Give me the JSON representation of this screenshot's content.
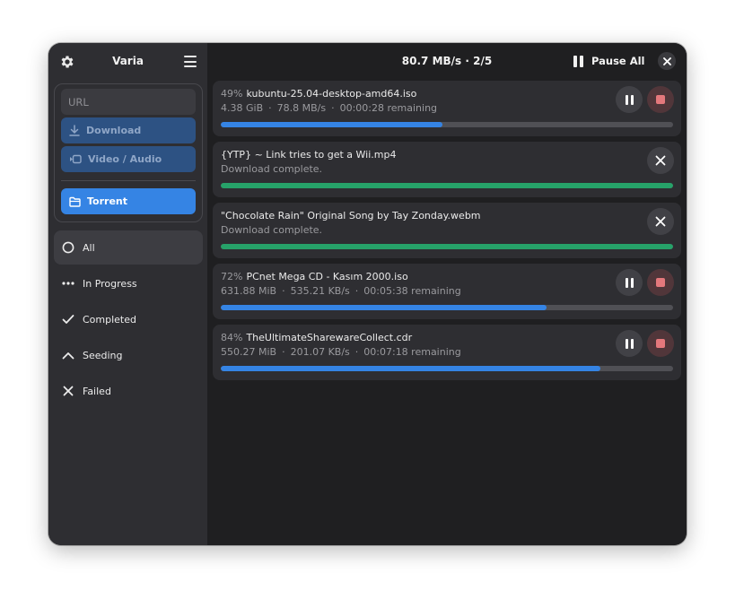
{
  "app": {
    "title": "Varia"
  },
  "sidebar": {
    "url_placeholder": "URL",
    "download_label": "Download",
    "video_audio_label": "Video / Audio",
    "torrent_label": "Torrent",
    "filters": [
      {
        "label": "All",
        "icon": "circle-icon",
        "active": true
      },
      {
        "label": "In Progress",
        "icon": "dots-icon",
        "active": false
      },
      {
        "label": "Completed",
        "icon": "check-icon",
        "active": false
      },
      {
        "label": "Seeding",
        "icon": "chevron-up-icon",
        "active": false
      },
      {
        "label": "Failed",
        "icon": "x-icon",
        "active": false
      }
    ]
  },
  "header": {
    "speed_text": "80.7 MB/s  ·  2/5",
    "pause_all_label": "Pause All"
  },
  "colors": {
    "accent": "#3584e4",
    "success": "#26a269",
    "stop": "#e4787c"
  },
  "downloads": [
    {
      "percent": "49%",
      "name": "kubuntu-25.04-desktop-amd64.iso",
      "size": "4.38 GiB",
      "speed": "78.8  MB/s",
      "remaining": "00:00:28 remaining",
      "progress": 0.49,
      "status": "in-progress"
    },
    {
      "percent": "",
      "name": "{YTP} ~ Link tries to get a Wii.mp4",
      "status_text": "Download complete.",
      "progress": 1.0,
      "status": "completed"
    },
    {
      "percent": "",
      "name": "\"Chocolate Rain\" Original Song by Tay Zonday.webm",
      "status_text": "Download complete.",
      "progress": 1.0,
      "status": "completed"
    },
    {
      "percent": "72%",
      "name": "PCnet Mega CD - Kasım 2000.iso",
      "size": "631.88 MiB",
      "speed": "535.21  KB/s",
      "remaining": "00:05:38 remaining",
      "progress": 0.72,
      "status": "in-progress"
    },
    {
      "percent": "84%",
      "name": "TheUltimateSharewareCollect.cdr",
      "size": "550.27 MiB",
      "speed": "201.07  KB/s",
      "remaining": "00:07:18 remaining",
      "progress": 0.84,
      "status": "in-progress"
    }
  ]
}
